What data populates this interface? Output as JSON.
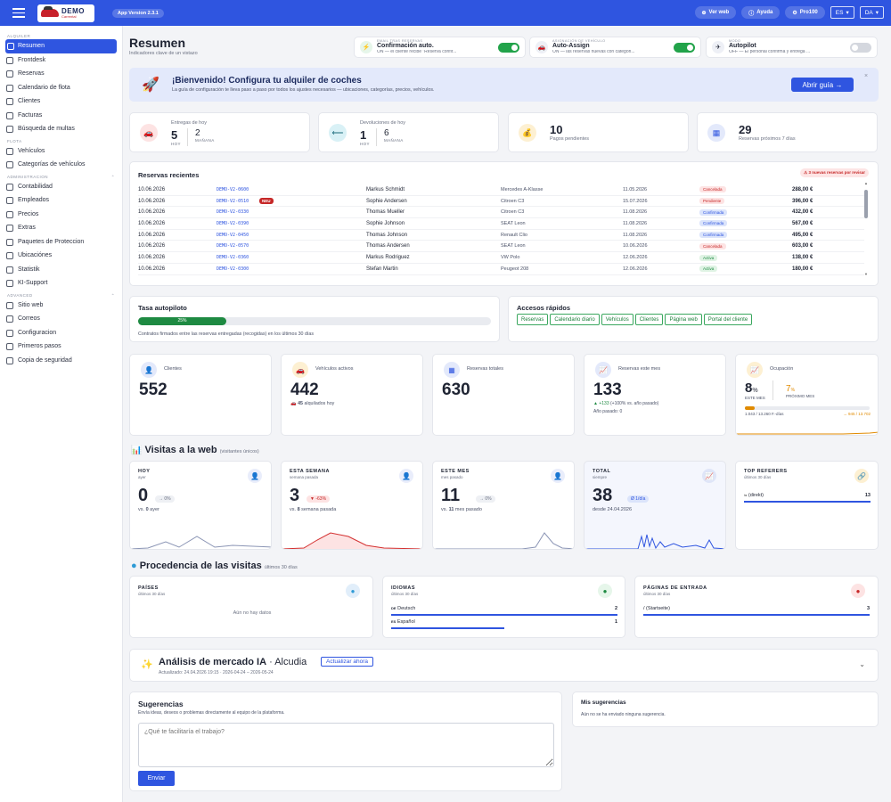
{
  "topbar": {
    "version": "App Version 2.3.1",
    "logo_text": "DEMO",
    "logo_sub": "Carrental",
    "ver_web": "Ver web",
    "ayuda": "Ayuda",
    "pro": "Pro100",
    "lang": "ES",
    "country": "DA"
  },
  "sidebar": {
    "g1": "ALQUILER",
    "g2": "FLOTA",
    "g3": "ADMINISTRACION",
    "g4": "ADVANCED",
    "alquiler": [
      "Resumen",
      "Frontdesk",
      "Reservas",
      "Calendario de flota",
      "Clientes",
      "Facturas",
      "Búsqueda de multas"
    ],
    "flota": [
      "Vehículos",
      "Categorías de vehículos"
    ],
    "admin": [
      "Contabilidad",
      "Empleados",
      "Precios",
      "Extras",
      "Paquetes de Proteccion",
      "Ubicaciónes",
      "Statistik",
      "KI-Support"
    ],
    "advanced": [
      "Sitio web",
      "Correos",
      "Configuracion",
      "Primeros pasos",
      "Copia de seguridad"
    ]
  },
  "header": {
    "title": "Resumen",
    "subtitle": "Indicadores clave de un vistazo"
  },
  "toggles": [
    {
      "label": "EMAIL TRAS RESERVAS",
      "name": "Confirmación auto.",
      "desc": "ON — el cliente recibe \"Reserva confir...",
      "on": true,
      "icon": "⚡"
    },
    {
      "label": "ASIGNACIÓN DE VEHÍCULO",
      "name": "Auto-Assign",
      "desc": "ON — las reservas nuevas con categori...",
      "on": true,
      "icon": "🚗"
    },
    {
      "label": "MODO",
      "name": "Autopilot",
      "desc": "OFF — El personal confirma y entrega ...",
      "on": false,
      "icon": "✈"
    }
  ],
  "banner": {
    "title": "¡Bienvenido! Configura tu alquiler de coches",
    "subtitle": "La guía de configuración te lleva paso a paso por todos los ajustes necesarios — ubicaciones, categorías, precios, vehículos.",
    "button": "Abrir guía →",
    "close": "×"
  },
  "kpis": {
    "entregas": {
      "title": "Entregas de hoy",
      "hoy": "5",
      "hoy_l": "HOY",
      "man": "2",
      "man_l": "MAÑANA"
    },
    "devol": {
      "title": "Devoluciones de hoy",
      "hoy": "1",
      "hoy_l": "HOY",
      "man": "6",
      "man_l": "MAÑANA"
    },
    "pagos": {
      "n": "10",
      "l": "Pagos pendientes"
    },
    "reservas7": {
      "n": "29",
      "l": "Reservas próximos 7 días"
    }
  },
  "recent": {
    "title": "Reservas recientes",
    "alert": "⚠ 3 nuevas reservas por revisar",
    "new_badge": "NEU",
    "rows": [
      [
        "10.06.2026",
        "DEMO-V2-0600",
        "Markus Schmidt",
        "Mercedes A-Klasse",
        "11.05.2026",
        "Cancelada",
        "288,00 €"
      ],
      [
        "10.06.2026",
        "DEMO-V2-0510",
        "Sophie Andersen",
        "Citroen C3",
        "15.07.2026",
        "Pendiente",
        "396,00 €"
      ],
      [
        "10.06.2026",
        "DEMO-V2-0330",
        "Thomas Mueller",
        "Citroen C3",
        "11.08.2026",
        "Confirmada",
        "432,00 €"
      ],
      [
        "10.06.2026",
        "DEMO-V2-0390",
        "Sophie Johnson",
        "SEAT Leon",
        "11.08.2026",
        "Confirmada",
        "567,00 €"
      ],
      [
        "10.06.2026",
        "DEMO-V2-0450",
        "Thomas Johnson",
        "Renault Clio",
        "11.08.2026",
        "Confirmada",
        "495,00 €"
      ],
      [
        "10.06.2026",
        "DEMO-V2-0570",
        "Thomas Andersen",
        "SEAT Leon",
        "10.06.2026",
        "Cancelada",
        "603,00 €"
      ],
      [
        "10.06.2026",
        "DEMO-V2-0360",
        "Markus Rodriguez",
        "VW Polo",
        "12.06.2026",
        "Activa",
        "138,00 €"
      ],
      [
        "10.06.2026",
        "DEMO-V2-0300",
        "Stefan Martin",
        "Peugeot 208",
        "12.06.2026",
        "Activa",
        "180,00 €"
      ]
    ]
  },
  "autopilot": {
    "title": "Tasa autopiloto",
    "pct": "25%",
    "desc": "Contratos firmados entre las reservas entregadas (recogidas) en los últimos 30 días"
  },
  "accesos": {
    "title": "Accesos rápidos",
    "items": [
      "Reservas",
      "Calendario diario",
      "Vehículos",
      "Clientes",
      "Página web",
      "Portal del cliente"
    ]
  },
  "stats": {
    "clientes": {
      "l": "Clientes",
      "n": "552"
    },
    "vehiculos": {
      "l": "Vehículos activos",
      "n": "442",
      "s": "45",
      "s2": "alquilados hoy"
    },
    "reservas": {
      "l": "Reservas totales",
      "n": "630"
    },
    "mes": {
      "l": "Reservas este mes",
      "n": "133",
      "s": "▲ +133",
      "s2": "(+100% vs. año pasado)",
      "s3": "Año pasado: 0"
    },
    "ocup": {
      "l": "Ocupación",
      "n": "8",
      "u": "%",
      "l2": "ESTE MES",
      "n2": "7",
      "u2": "%",
      "l3": "PRÓXIMO MES",
      "d": "1.043 / 13.260 F.-días",
      "d2": "→ 945 / 13.702"
    }
  },
  "web": {
    "title": "Visitas a la web",
    "sub": "(visitantes únicos)",
    "hoy": {
      "l": "HOY",
      "s": "ayer",
      "n": "0",
      "b": "→ 0%",
      "c1": "vs. ",
      "c2": "0",
      "c3": " ayer"
    },
    "semana": {
      "l": "ESTA SEMANA",
      "s": "semana pasada",
      "n": "3",
      "b": "▼ -63%",
      "c1": "vs. ",
      "c2": "8",
      "c3": " semana pasada"
    },
    "mes": {
      "l": "ESTE MES",
      "s": "mes pasado",
      "n": "11",
      "b": "→ 0%",
      "c1": "vs. ",
      "c2": "11",
      "c3": " mes pasado"
    },
    "total": {
      "l": "TOTAL",
      "s": "siempre",
      "n": "38",
      "b": "Ø 1/día",
      "c": "desde 24.04.2026"
    },
    "ref": {
      "l": "TOP REFERERS",
      "s": "últimos 30 días",
      "item": "(direkt)",
      "v": "13"
    }
  },
  "proc": {
    "title": "Procedencia de las visitas",
    "sub": "últimos 30 días",
    "paises": {
      "l": "PAÍSES",
      "s": "últimos 30 días",
      "empty": "Aún no hay datos"
    },
    "idiomas": {
      "l": "IDIOMAS",
      "s": "últimos 30 días",
      "items": [
        {
          "code": "DE",
          "name": "Deutsch",
          "v": "2",
          "frac": 1.0
        },
        {
          "code": "ES",
          "name": "Español",
          "v": "1",
          "frac": 0.5
        }
      ]
    },
    "paginas": {
      "l": "PÁGINAS DE ENTRADA",
      "s": "últimos 30 días",
      "item": "/ (Startseite)",
      "v": "3"
    }
  },
  "ia": {
    "title": "Análisis de mercado IA",
    "loc": "· Alcudia",
    "btn": "Actualizar ahora",
    "upd": "Actualizado: 24.04.2026 19:15 · 2026-04-24 – 2026-05-24"
  },
  "sug": {
    "title": "Sugerencias",
    "sub": "Envía ideas, deseos o problemas directamente al equipo de la plataforma.",
    "placeholder": "¿Qué te facilitaría el trabajo?",
    "btn": "Enviar",
    "mis": "Mis sugerencias",
    "none": "Aún no se ha enviado ninguna sugerencia."
  },
  "colors": {
    "accent": "#2f55e0",
    "green": "#22a34a",
    "red": "#d32f2f"
  }
}
